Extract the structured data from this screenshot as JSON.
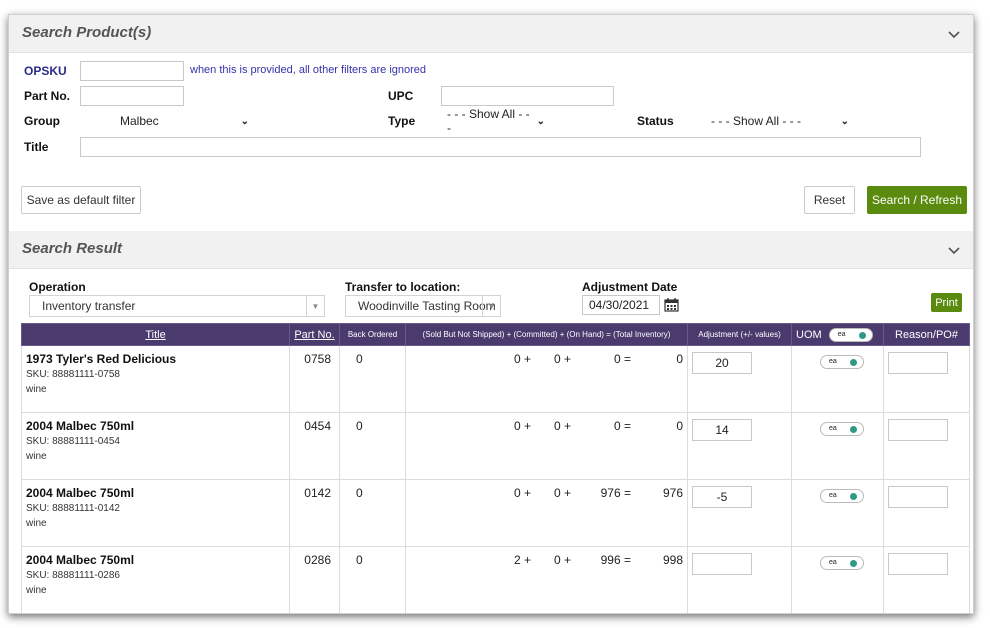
{
  "search_panel": {
    "title": "Search Product(s)",
    "opsku_label": "OPSKU",
    "opsku_value": "",
    "opsku_note": "when this is provided, all other filters are ignored",
    "partno_label": "Part No.",
    "partno_value": "",
    "upc_label": "UPC",
    "upc_value": "",
    "group_label": "Group",
    "group_value": "Malbec",
    "type_label": "Type",
    "type_value": "- - - Show All - - -",
    "status_label": "Status",
    "status_value": "- - - Show All - - -",
    "title_label": "Title",
    "title_value": "",
    "save_default": "Save as default filter",
    "reset": "Reset",
    "search_refresh": "Search / Refresh"
  },
  "result_panel": {
    "title": "Search Result",
    "operation_label": "Operation",
    "operation_value": "Inventory transfer",
    "transfer_label": "Transfer to location:",
    "transfer_value": "Woodinville Tasting Room",
    "adj_date_label": "Adjustment Date",
    "adj_date_value": "04/30/2021",
    "print": "Print"
  },
  "table": {
    "headers": {
      "title": "Title",
      "part_no": "Part No.",
      "back_ordered": "Back Ordered",
      "inventory": "(Sold But Not Shipped) + (Committed) + (On Hand) = (Total Inventory)",
      "adjustment": "Adjustment (+/- values)",
      "uom": "UOM",
      "uom_toggle": "ea",
      "reason": "Reason/PO#"
    },
    "rows": [
      {
        "name": "1973 Tyler's Red Delicious",
        "sku": "SKU: 88881111-0758",
        "type": "wine",
        "part": "0758",
        "back": "0",
        "sold": "0 +",
        "committed": "0 +",
        "onhand": "0 =",
        "total": "0",
        "adj": "20",
        "uom": "ea",
        "reason": ""
      },
      {
        "name": "2004 Malbec 750ml",
        "sku": "SKU: 88881111-0454",
        "type": "wine",
        "part": "0454",
        "back": "0",
        "sold": "0 +",
        "committed": "0 +",
        "onhand": "0 =",
        "total": "0",
        "adj": "14",
        "uom": "ea",
        "reason": ""
      },
      {
        "name": "2004 Malbec 750ml",
        "sku": "SKU: 88881111-0142",
        "type": "wine",
        "part": "0142",
        "back": "0",
        "sold": "0 +",
        "committed": "0 +",
        "onhand": "976 =",
        "total": "976",
        "adj": "-5",
        "uom": "ea",
        "reason": ""
      },
      {
        "name": "2004 Malbec 750ml",
        "sku": "SKU: 88881111-0286",
        "type": "wine",
        "part": "0286",
        "back": "0",
        "sold": "2 +",
        "committed": "0 +",
        "onhand": "996 =",
        "total": "998",
        "adj": "",
        "uom": "ea",
        "reason": ""
      }
    ]
  }
}
